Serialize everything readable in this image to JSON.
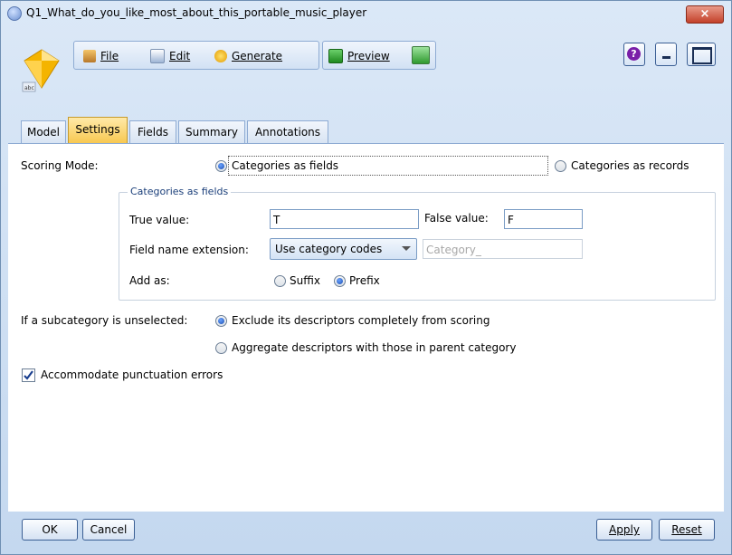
{
  "window": {
    "title": "Q1_What_do_you_like_most_about_this_portable_music_player",
    "close_label": "×"
  },
  "toolbar": {
    "file_label": "File",
    "edit_label": "Edit",
    "generate_label": "Generate",
    "preview_label": "Preview",
    "help_label": "?"
  },
  "tabs": [
    {
      "label": "Model",
      "active": false
    },
    {
      "label": "Settings",
      "active": true
    },
    {
      "label": "Fields",
      "active": false
    },
    {
      "label": "Summary",
      "active": false
    },
    {
      "label": "Annotations",
      "active": false
    }
  ],
  "settings": {
    "scoring_mode_label": "Scoring Mode:",
    "scoring_option_fields": "Categories as fields",
    "scoring_option_records": "Categories as records",
    "scoring_selected": "Categories as fields",
    "group_label": "Categories as fields",
    "true_value_label": "True value:",
    "true_value": "T",
    "false_value_label": "False value:",
    "false_value": "F",
    "field_name_extension_label": "Field name extension:",
    "field_name_extension_selected": "Use category codes",
    "extension_placeholder": "Category_",
    "add_as_label": "Add as:",
    "add_as_suffix": "Suffix",
    "add_as_prefix": "Prefix",
    "add_as_selected": "Prefix",
    "subcategory_label": "If a subcategory is unselected:",
    "subcategory_option_exclude": "Exclude its descriptors completely from scoring",
    "subcategory_option_aggregate": "Aggregate descriptors with those in parent category",
    "subcategory_selected": "Exclude its descriptors completely from scoring",
    "punctuation_label": "Accommodate punctuation errors",
    "punctuation_checked": true
  },
  "buttons": {
    "ok": "OK",
    "cancel": "Cancel",
    "apply": "Apply",
    "reset": "Reset"
  },
  "colors": {
    "active_tab": "#f7c74e",
    "window_frame": "#c4d8ef",
    "close_button": "#c3412a",
    "checkmark": "#1a3f8f"
  }
}
